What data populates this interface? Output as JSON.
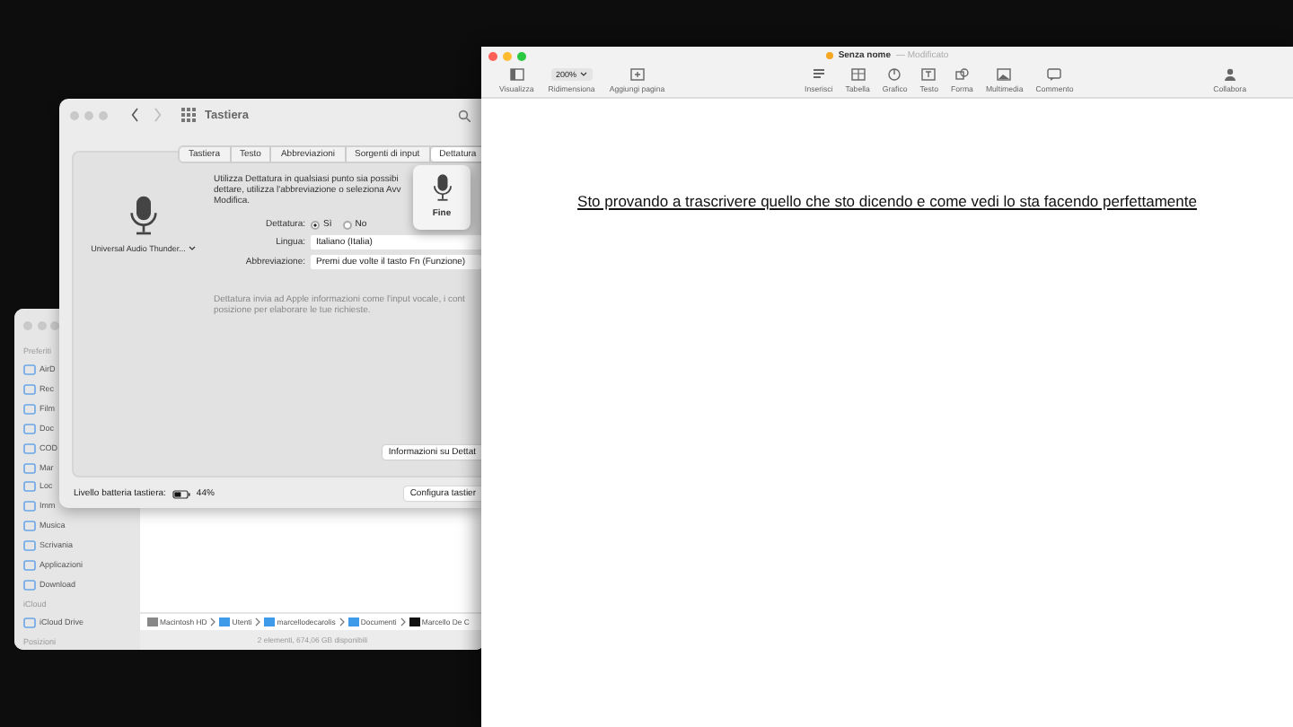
{
  "finder": {
    "sidebar": [
      {
        "header": "Preferiti",
        "items": [
          "AirD",
          "Rec",
          "Film",
          "Doc",
          "COD",
          "Mar",
          "Loc",
          "Imm",
          "Musica",
          "Scrivania",
          "Applicazioni",
          "Download"
        ]
      },
      {
        "header": "iCloud",
        "items": [
          "iCloud Drive"
        ]
      },
      {
        "header": "Posizioni"
      }
    ],
    "path": [
      {
        "label": "Macintosh HD",
        "kind": "disk"
      },
      {
        "label": "Utenti",
        "kind": "folder"
      },
      {
        "label": "marcellodecarolis",
        "kind": "home"
      },
      {
        "label": "Documenti",
        "kind": "folder"
      },
      {
        "label": "Marcello De C",
        "kind": "file"
      }
    ],
    "status": "2 elementi, 674,06 GB disponibili"
  },
  "keyboard_window": {
    "title": "Tastiera",
    "tabs": [
      {
        "label": "Tastiera",
        "selected": false
      },
      {
        "label": "Testo",
        "selected": false
      },
      {
        "label": "Abbreviazioni",
        "selected": false
      },
      {
        "label": "Sorgenti di input",
        "selected": false
      },
      {
        "label": "Dettatura",
        "selected": true
      }
    ],
    "microphone_label": "Universal Audio Thunder...",
    "description": [
      "Utilizza Dettatura in qualsiasi punto sia possibi",
      "dettare, utilizza l'abbreviazione o seleziona Avv",
      "Modifica."
    ],
    "dictation": {
      "label": "Dettatura:",
      "options": [
        {
          "label": "Sì",
          "selected": true
        },
        {
          "label": "No",
          "selected": false
        }
      ]
    },
    "fields": [
      {
        "label": "Lingua:",
        "value": "Italiano (Italia)"
      },
      {
        "label": "Abbreviazione:",
        "value": "Premi due volte il tasto Fn (Funzione)"
      }
    ],
    "note": [
      "Dettatura invia ad Apple informazioni come l'input vocale, i cont",
      "posizione per elaborare le tue richieste."
    ],
    "info_button": "Informazioni su Dettat",
    "battery": {
      "label": "Livello batteria tastiera:",
      "reading": "44%"
    },
    "configure_button": "Configura tastier",
    "popover": {
      "label": "Fine"
    }
  },
  "pages": {
    "title": "Senza nome",
    "status": "— Modificato",
    "edited": true,
    "toolbar": {
      "left": [
        {
          "label": "Visualizza",
          "kind": "icon"
        },
        {
          "label": "Ridimensiona",
          "kind": "zoom",
          "value": "200%"
        },
        {
          "label": "Aggiungi pagina",
          "kind": "icon"
        }
      ],
      "center": [
        {
          "label": "Inserisci",
          "kind": "icon"
        },
        {
          "label": "Tabella",
          "kind": "icon"
        },
        {
          "label": "Grafico",
          "kind": "icon"
        },
        {
          "label": "Testo",
          "kind": "icon"
        },
        {
          "label": "Forma",
          "kind": "icon"
        },
        {
          "label": "Multimedia",
          "kind": "icon"
        },
        {
          "label": "Commento",
          "kind": "icon"
        }
      ],
      "right": [
        {
          "label": "Collabora",
          "kind": "icon"
        }
      ]
    },
    "document_text": "Sto provando a trascrivere quello che sto dicendo e come vedi lo sta facendo perfettamente"
  }
}
